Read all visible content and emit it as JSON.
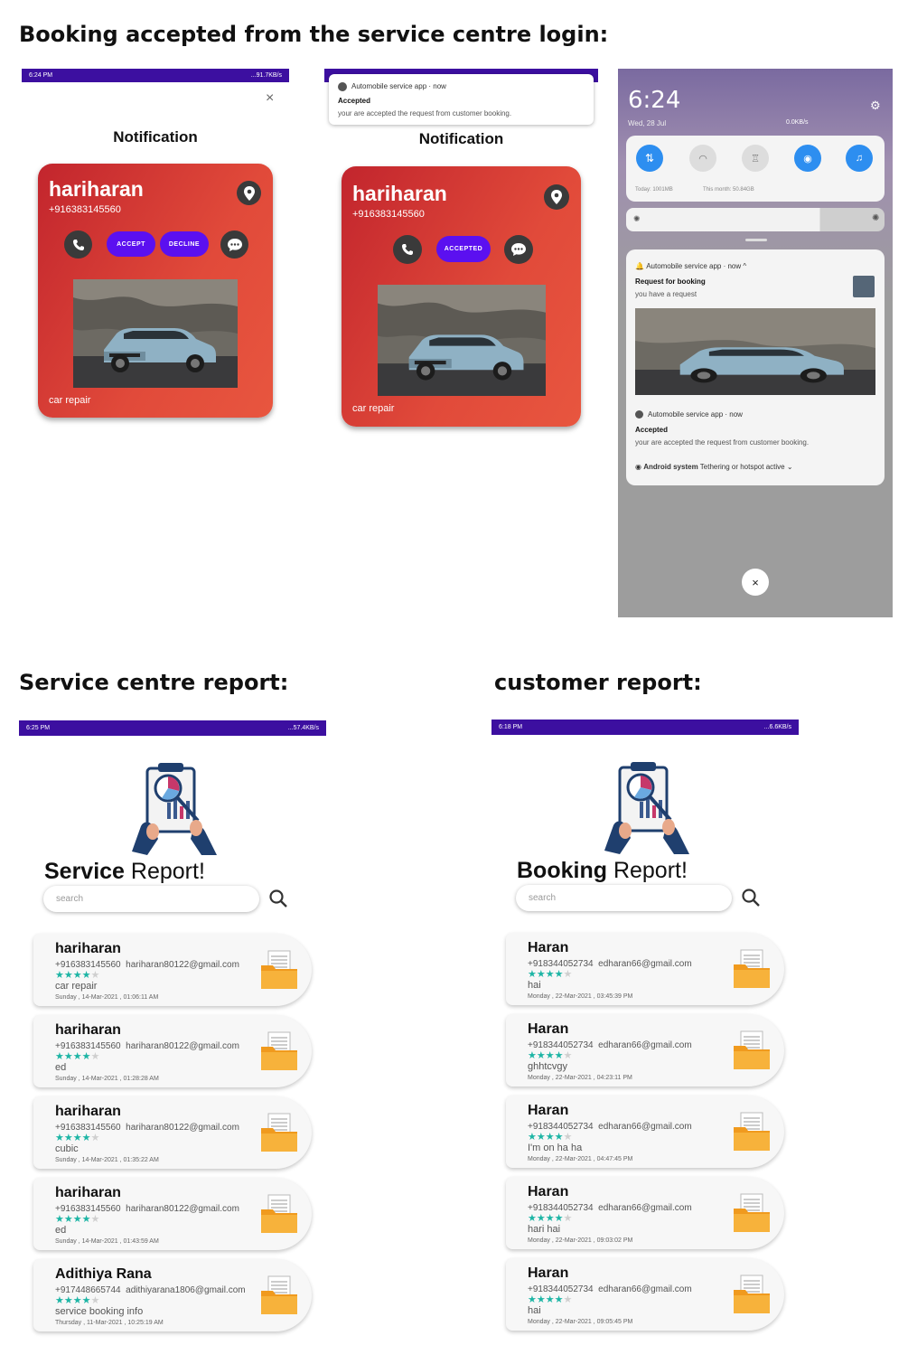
{
  "headings": {
    "top": "Booking accepted from the service centre login:",
    "service_report": "Service centre report:",
    "customer_report": "customer report:"
  },
  "colors": {
    "status_bar": "#3c0fa0",
    "card_red": "#d83a34",
    "pill_purple": "#5b10f0",
    "star_teal": "#1db5a5"
  },
  "screen1": {
    "status_time": "6:24 PM",
    "status_right": "...91.7KB/s",
    "close": "×",
    "title": "Notification",
    "card": {
      "name": "hariharan",
      "phone": "+916383145560",
      "accept": "ACCEPT",
      "decline": "DECLINE",
      "category": "car repair"
    }
  },
  "screen2": {
    "notif_app": "Automobile service app · now",
    "notif_title": "Accepted",
    "notif_body": "your are accepted the request from customer booking.",
    "title": "Notification",
    "card": {
      "name": "hariharan",
      "phone": "+916383145560",
      "accepted": "ACCEPTED",
      "category": "car repair"
    }
  },
  "screen3": {
    "time": "6:24",
    "date": "Wed, 28 Jul",
    "net": "0.0KB/s",
    "usage_today": "Today: 1001MB",
    "usage_month": "This month: 50.84GB",
    "n1_app": "Automobile service app · now ^",
    "n1_title": "Request for booking",
    "n1_body": "you have a request",
    "n2_app": "Automobile service app · now",
    "n2_title": "Accepted",
    "n2_body": "your are accepted the request from customer booking.",
    "n3_app": "Android system",
    "n3_body": "Tethering or hotspot active ⌄",
    "close": "×"
  },
  "service_report": {
    "status_time": "6:25 PM",
    "status_right": "...57.4KB/s",
    "title_bold": "Service",
    "title_rest": " Report!",
    "search_placeholder": "search",
    "rows": [
      {
        "name": "hariharan",
        "phone": "+916383145560",
        "email": "hariharan80122@gmail.com",
        "rating": 4,
        "service": "car repair",
        "time": "Sunday , 14-Mar-2021 , 01:06:11 AM"
      },
      {
        "name": "hariharan",
        "phone": "+916383145560",
        "email": "hariharan80122@gmail.com",
        "rating": 4,
        "service": "ed",
        "time": "Sunday , 14-Mar-2021 , 01:28:28 AM"
      },
      {
        "name": "hariharan",
        "phone": "+916383145560",
        "email": "hariharan80122@gmail.com",
        "rating": 4,
        "service": "cubic",
        "time": "Sunday , 14-Mar-2021 , 01:35:22 AM"
      },
      {
        "name": "hariharan",
        "phone": "+916383145560",
        "email": "hariharan80122@gmail.com",
        "rating": 4,
        "service": "ed",
        "time": "Sunday , 14-Mar-2021 , 01:43:59 AM"
      },
      {
        "name": "Adithiya Rana",
        "phone": "+917448665744",
        "email": "adithiyarana1806@gmail.com",
        "rating": 4,
        "service": "service booking info",
        "time": "Thursday , 11-Mar-2021 , 10:25:19 AM"
      }
    ]
  },
  "customer_report": {
    "status_time": "6:18 PM",
    "status_right": "...6.6KB/s",
    "title_bold": "Booking",
    "title_rest": " Report!",
    "search_placeholder": "search",
    "rows": [
      {
        "name": "Haran",
        "phone": "+918344052734",
        "email": "edharan66@gmail.com",
        "rating": 4,
        "service": "hai",
        "time": "Monday , 22-Mar-2021 , 03:45:39 PM"
      },
      {
        "name": "Haran",
        "phone": "+918344052734",
        "email": "edharan66@gmail.com",
        "rating": 4,
        "service": "ghhtcvgy",
        "time": "Monday , 22-Mar-2021 , 04:23:11 PM"
      },
      {
        "name": "Haran",
        "phone": "+918344052734",
        "email": "edharan66@gmail.com",
        "rating": 4,
        "service": "I'm on ha ha",
        "time": "Monday , 22-Mar-2021 , 04:47:45 PM"
      },
      {
        "name": "Haran",
        "phone": "+918344052734",
        "email": "edharan66@gmail.com",
        "rating": 4,
        "service": "hari hai",
        "time": "Monday , 22-Mar-2021 , 09:03:02 PM"
      },
      {
        "name": "Haran",
        "phone": "+918344052734",
        "email": "edharan66@gmail.com",
        "rating": 4,
        "service": "hai",
        "time": "Monday , 22-Mar-2021 , 09:05:45 PM"
      }
    ]
  }
}
